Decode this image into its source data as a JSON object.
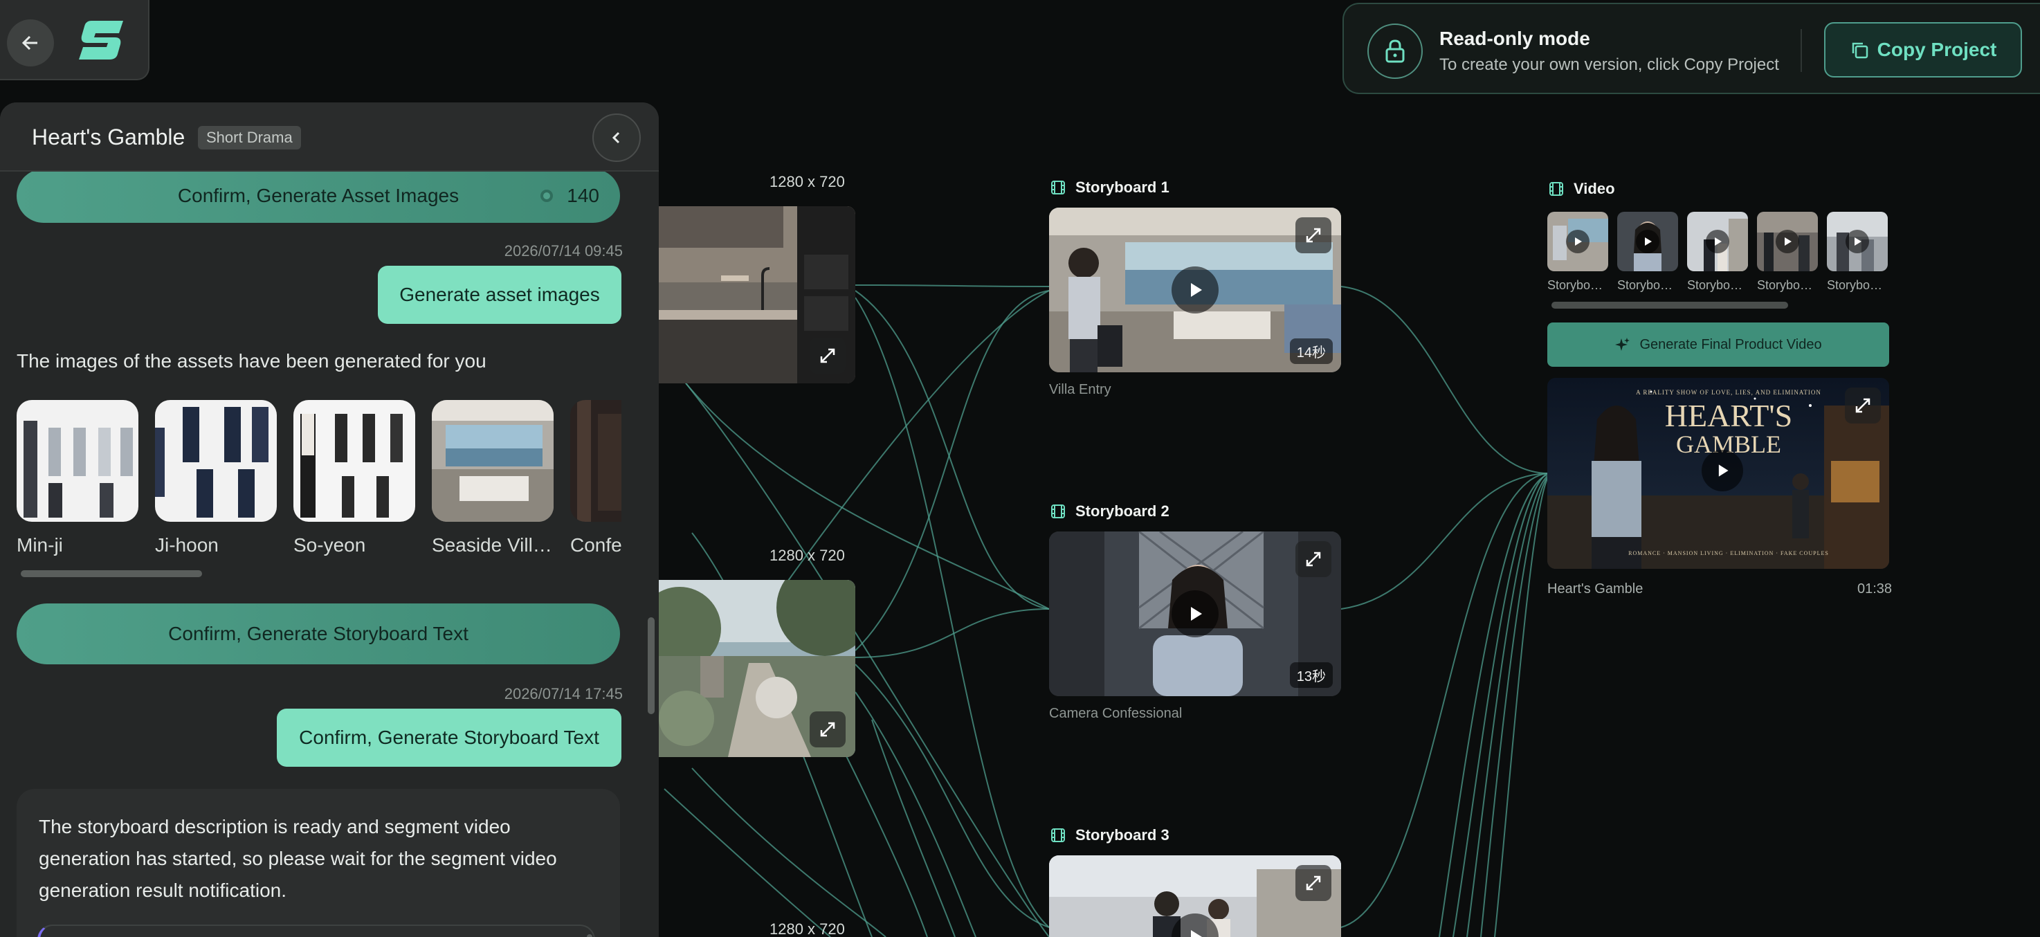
{
  "banner": {
    "title": "Read-only mode",
    "subtitle": "To create your own version, click Copy Project",
    "copy_label": "Copy Project"
  },
  "project": {
    "title": "Heart's Gamble",
    "tag": "Short Drama"
  },
  "chat": {
    "confirm_assets_label": "Confirm, Generate Asset Images",
    "confirm_assets_cost": "140",
    "msg1_time": "2026/07/14 09:45",
    "msg1_text": "Generate asset images",
    "bot_assets_text": "The images of the assets have been generated for you",
    "assets": [
      {
        "label": "Min-ji"
      },
      {
        "label": "Ji-hoon"
      },
      {
        "label": "So-yeon"
      },
      {
        "label": "Seaside Vill…"
      },
      {
        "label": "Confe"
      }
    ],
    "confirm_storyboard_label": "Confirm, Generate Storyboard Text",
    "msg2_time": "2026/07/14 17:45",
    "msg2_text": "Confirm, Generate Storyboard Text",
    "bot_card_text": "The storyboard description is ready and segment video generation has started, so please wait for the segment video generation result notification."
  },
  "image_nodes": [
    {
      "dims": "1280 x 720"
    },
    {
      "dims": "1280 x 720"
    },
    {
      "dims": "1280 x 720"
    }
  ],
  "storyboards": [
    {
      "title": "Storyboard 1",
      "duration": "14秒",
      "caption": "Villa Entry"
    },
    {
      "title": "Storyboard 2",
      "duration": "13秒",
      "caption": "Camera Confessional"
    },
    {
      "title": "Storyboard 3"
    }
  ],
  "video": {
    "title": "Video",
    "thumbs": [
      {
        "label": "Storyboa…"
      },
      {
        "label": "Storyboa…"
      },
      {
        "label": "Storyboa…"
      },
      {
        "label": "Storyboa…"
      },
      {
        "label": "Storyboa…"
      }
    ],
    "generate_label": "Generate Final Product Video",
    "final_poster": {
      "tagline": "A REALITY SHOW OF LOVE, LIES, AND ELIMINATION",
      "title_line1": "HEART'S",
      "title_line2": "GAMBLE",
      "bottom_line": "ROMANCE · MANSION LIVING · ELIMINATION · FAKE COUPLES"
    },
    "final_title": "Heart's Gamble",
    "final_duration": "01:38"
  },
  "colors": {
    "accent": "#6fe0c2",
    "wire": "#4f9e8d",
    "user_bubble": "#7fe0c0",
    "panel_bg": "#252727",
    "canvas_bg": "#0b0d0d"
  }
}
